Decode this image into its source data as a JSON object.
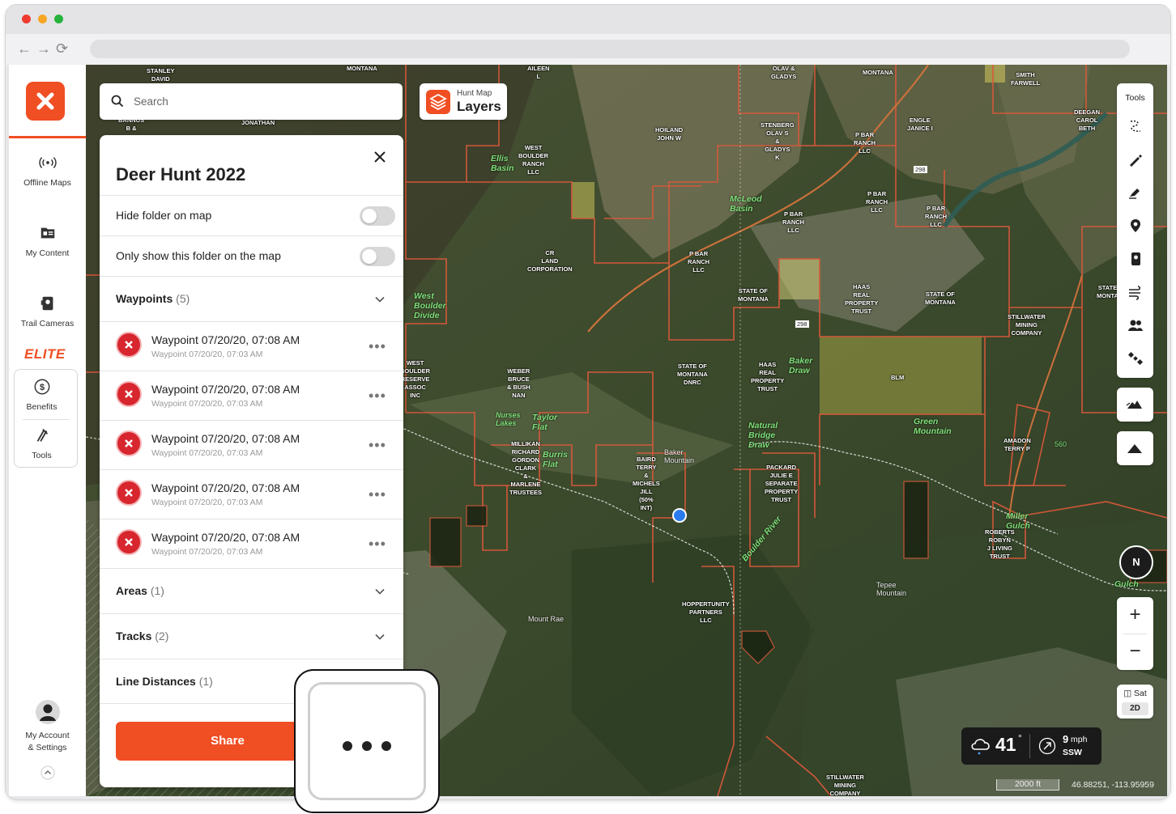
{
  "sidebar": {
    "items": [
      {
        "label": "Offline Maps",
        "icon": "offline-maps-icon"
      },
      {
        "label": "My Content",
        "icon": "my-content-icon"
      },
      {
        "label": "Trail Cameras",
        "icon": "trail-camera-icon"
      }
    ],
    "elite_label": "ELITE",
    "elite_items": [
      {
        "label": "Benefits",
        "icon": "dollar-icon"
      },
      {
        "label": "Tools",
        "icon": "tools-icon"
      }
    ],
    "account": {
      "line1": "My Account",
      "line2": "& Settings"
    }
  },
  "search": {
    "placeholder": "Search"
  },
  "layers_button": {
    "small": "Hunt Map",
    "label": "Layers"
  },
  "folder": {
    "title": "Deer Hunt 2022",
    "hide_on_map_label": "Hide folder on map",
    "only_show_label": "Only show this folder on the map",
    "sections": [
      {
        "name": "Waypoints",
        "count": "(5)"
      },
      {
        "name": "Areas",
        "count": "(1)"
      },
      {
        "name": "Tracks",
        "count": "(2)"
      },
      {
        "name": "Line Distances",
        "count": "(1)"
      }
    ],
    "waypoints": [
      {
        "title": "Waypoint 07/20/20, 07:08 AM",
        "subtitle": "Waypoint 07/20/20, 07:03 AM"
      },
      {
        "title": "Waypoint 07/20/20, 07:08 AM",
        "subtitle": "Waypoint 07/20/20, 07:03 AM"
      },
      {
        "title": "Waypoint 07/20/20, 07:08 AM",
        "subtitle": "Waypoint 07/20/20, 07:03 AM"
      },
      {
        "title": "Waypoint 07/20/20, 07:08 AM",
        "subtitle": "Waypoint 07/20/20, 07:03 AM"
      },
      {
        "title": "Waypoint 07/20/20, 07:08 AM",
        "subtitle": "Waypoint 07/20/20, 07:03 AM"
      }
    ],
    "more_glyph": "•••",
    "share_label": "Share"
  },
  "tools": {
    "label": "Tools"
  },
  "compass": {
    "label": "N"
  },
  "zoom": {
    "in": "+",
    "out": "−"
  },
  "map_type": {
    "label": "Sat",
    "mode": "2D"
  },
  "weather": {
    "temp": "41",
    "degree": "°",
    "wind_speed": "9",
    "wind_unit": "mph",
    "wind_dir": "SSW"
  },
  "scale": {
    "label": "2000 ft",
    "coords": "46.88251, -113.95959"
  },
  "map_labels": [
    {
      "text": "STANLEY\nDAVID"
    },
    {
      "text": "MONTANA"
    },
    {
      "text": "AILEEN\nL"
    },
    {
      "text": "OLAV &\nGLADYS"
    },
    {
      "text": "MONTANA"
    },
    {
      "text": "SMITH\nFARWELL"
    },
    {
      "text": "BANNUS\nB &"
    },
    {
      "text": "JONATHAN"
    },
    {
      "text": "HOILAND\nJOHN W"
    },
    {
      "text": "STENBERG\nOLAV S\n&\nGLADYS\nK"
    },
    {
      "text": "P BAR\nRANCH\nLLC"
    },
    {
      "text": "ENGLE\nJANICE I"
    },
    {
      "text": "DEEGAN\nCAROL\nBETH"
    },
    {
      "text": "WEST\nBOULDER\nRANCH\nLLC"
    },
    {
      "text": "P BAR\nRANCH\nLLC"
    },
    {
      "text": "P BAR\nRANCH\nLLC"
    },
    {
      "text": "P BAR\nRANCH\nLLC"
    },
    {
      "text": "CR\nLAND\nCORPORATION"
    },
    {
      "text": "P BAR\nRANCH\nLLC"
    },
    {
      "text": "STATE OF\nMONTANA"
    },
    {
      "text": "HAAS\nREAL\nPROPERTY\nTRUST"
    },
    {
      "text": "STATE OF\nMONTANA"
    },
    {
      "text": "STATE\nMONTA"
    },
    {
      "text": "STILLWATER\nMINING\nCOMPANY"
    },
    {
      "text": "WEST\nBOULDER\nRESERVE\nASSOC\nINC"
    },
    {
      "text": "WEBER\nBRUCE\n& BUSH\nNAN"
    },
    {
      "text": "STATE OF\nMONTANA\nDNRC"
    },
    {
      "text": "HAAS\nREAL\nPROPERTY\nTRUST"
    },
    {
      "text": "BLM"
    },
    {
      "text": "MILLIKAN\nRICHARD\nGORDON\nCLARK\n&\nMARLENE\nTRUSTEES"
    },
    {
      "text": "BAIRD\nTERRY\n&\nMICHELS\nJILL\n(50%\nINT)"
    },
    {
      "text": "PACKARD\nJULIE E\nSEPARATE\nPROPERTY\nTRUST"
    },
    {
      "text": "AMADON\nTERRY P"
    },
    {
      "text": "ROBERTS\nROBYN\nJ LIVING\nTRUST"
    },
    {
      "text": "HOPPERTUNITY\nPARTNERS\nLLC"
    },
    {
      "text": "STILLWATER\nMINING\nCOMPANY"
    }
  ],
  "map_green_labels": [
    {
      "text": "Ellis\nBasin"
    },
    {
      "text": "McLeod\nBasin"
    },
    {
      "text": "West\nBoulder\nDivide"
    },
    {
      "text": "Nurses\nLakes"
    },
    {
      "text": "Taylor\nFlat"
    },
    {
      "text": "Burris\nFlat"
    },
    {
      "text": "Baker\nDraw"
    },
    {
      "text": "Green\nMountain"
    },
    {
      "text": "Natural\nBridge\nDraw"
    },
    {
      "text": "Miller\nGulch"
    },
    {
      "text": "Boulder River"
    },
    {
      "text": "Gulch"
    }
  ],
  "map_white_labels": [
    {
      "text": "Baker\nMountain"
    },
    {
      "text": "Tepee\nMountain"
    },
    {
      "text": "Mount Rae"
    },
    {
      "text": "560"
    },
    {
      "text": "298"
    },
    {
      "text": "298"
    }
  ]
}
